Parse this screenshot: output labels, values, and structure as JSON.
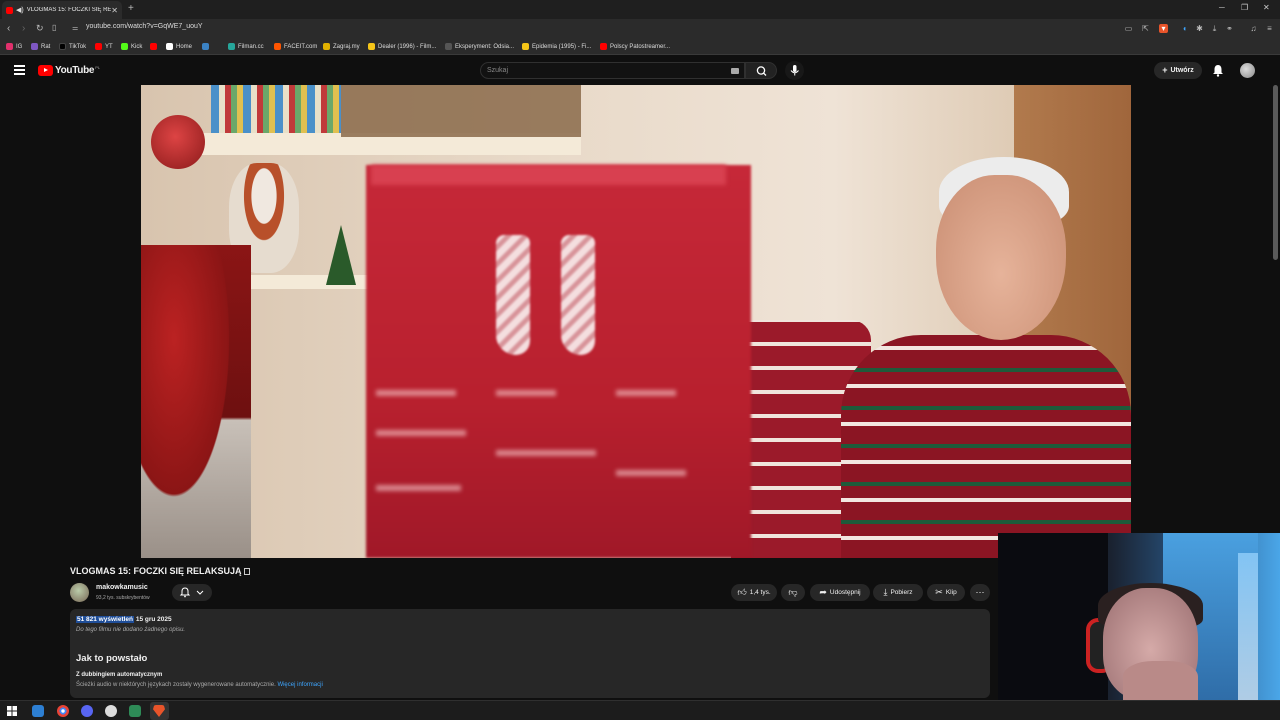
{
  "browser": {
    "tab_title": "VLOGMAS 15: FOCZKI SIĘ RE",
    "url": "youtube.com/watch?v=GqWE7_uouY",
    "bookmarks": [
      {
        "label": "IG",
        "color": "#e1306c"
      },
      {
        "label": "Rat",
        "color": "#7e57c2"
      },
      {
        "label": "TikTok",
        "color": "#111111"
      },
      {
        "label": "YT",
        "color": "#ff0000"
      },
      {
        "label": "Kick",
        "color": "#53fc18"
      },
      {
        "label": "",
        "color": "#ff0000"
      },
      {
        "label": "Home",
        "color": "#ffffff"
      },
      {
        "label": "",
        "color": "#3b82c4"
      },
      {
        "label": "Filman.cc",
        "color": "#26a69a"
      },
      {
        "label": "FACEIT.com",
        "color": "#ff5500"
      },
      {
        "label": "Zagraj.my",
        "color": "#e0b000"
      },
      {
        "label": "Dealer (1996) - Film...",
        "color": "#f5c518"
      },
      {
        "label": "Eksperyment: Odsia...",
        "color": "#555555"
      },
      {
        "label": "Epidemia (1995) - Fi...",
        "color": "#f5c518"
      },
      {
        "label": "Polscy Patostreamer...",
        "color": "#ff0000"
      }
    ]
  },
  "youtube": {
    "logo_text": "YouTube",
    "country_code": "PL",
    "search_placeholder": "Szukaj",
    "create_label": "Utwórz"
  },
  "video": {
    "title": "VLOGMAS 15: FOCZKI SIĘ RELAKSUJĄ",
    "channel_name": "makowkamusic",
    "subscribers": "93,2 tys. subskrybentów",
    "likes": "1,4 tys.",
    "share_label": "Udostępnij",
    "download_label": "Pobierz",
    "clip_label": "Klip"
  },
  "description": {
    "views": "51 821 wyświetleń",
    "date": "15 gru 2025",
    "no_description": "Do tego filmu nie dodano żadnego opisu.",
    "section_title": "Jak to powstało",
    "dub_title": "Z dubbingiem automatycznym",
    "dub_text": "Ścieżki audio w niektórych językach zostały wygenerowane automatycznie.",
    "more_info": "Więcej informacji"
  }
}
